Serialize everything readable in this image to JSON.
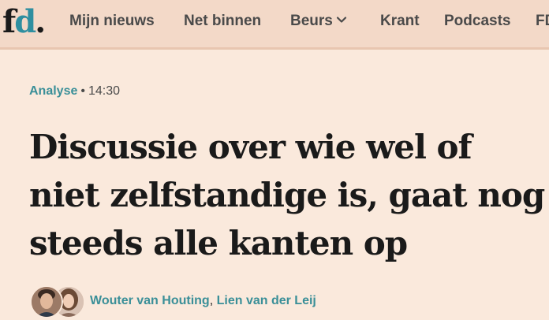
{
  "logo": {
    "text_f": "f",
    "text_d": "d",
    "text_dot": "."
  },
  "nav": {
    "items": [
      "Mijn nieuws",
      "Net binnen",
      "Beurs",
      "Krant",
      "Podcasts",
      "FD"
    ]
  },
  "article": {
    "category": "Analyse",
    "separator": "•",
    "time": "14:30",
    "headline": "Discussie over wie wel of niet zelfstandige is, gaat nog steeds alle kanten op",
    "authors": [
      "Wouter van Houting",
      "Lien van der Leij"
    ],
    "author_separator": ","
  },
  "colors": {
    "background": "#fae9dc",
    "navbar": "#f3d9c8",
    "accent": "#3a8f98",
    "text": "#1a1a1a"
  },
  "icons": {
    "beurs_dropdown": "chevron-down-icon"
  }
}
